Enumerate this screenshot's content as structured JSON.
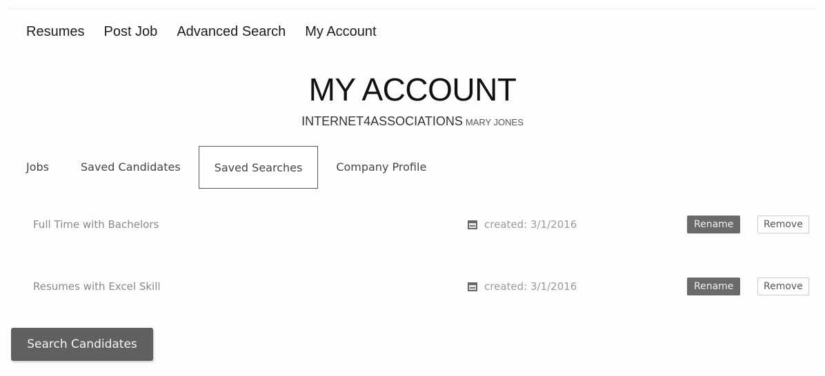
{
  "nav": {
    "items": [
      {
        "label": "Resumes"
      },
      {
        "label": "Post Job"
      },
      {
        "label": "Advanced Search"
      },
      {
        "label": "My Account"
      }
    ]
  },
  "header": {
    "title": "MY ACCOUNT",
    "organization": "INTERNET4ASSOCIATIONS",
    "user": "MARY JONES"
  },
  "tabs": [
    {
      "label": "Jobs",
      "active": false
    },
    {
      "label": "Saved Candidates",
      "active": false
    },
    {
      "label": "Saved Searches",
      "active": true
    },
    {
      "label": "Company Profile",
      "active": false
    }
  ],
  "saved_searches": [
    {
      "name": "Full Time with Bachelors",
      "created": "created: 3/1/2016",
      "rename_label": "Rename",
      "remove_label": "Remove"
    },
    {
      "name": "Resumes with Excel Skill",
      "created": "created: 3/1/2016",
      "rename_label": "Rename",
      "remove_label": "Remove"
    }
  ],
  "actions": {
    "search_candidates": "Search Candidates"
  },
  "icons": {
    "created": "calendar-icon"
  }
}
